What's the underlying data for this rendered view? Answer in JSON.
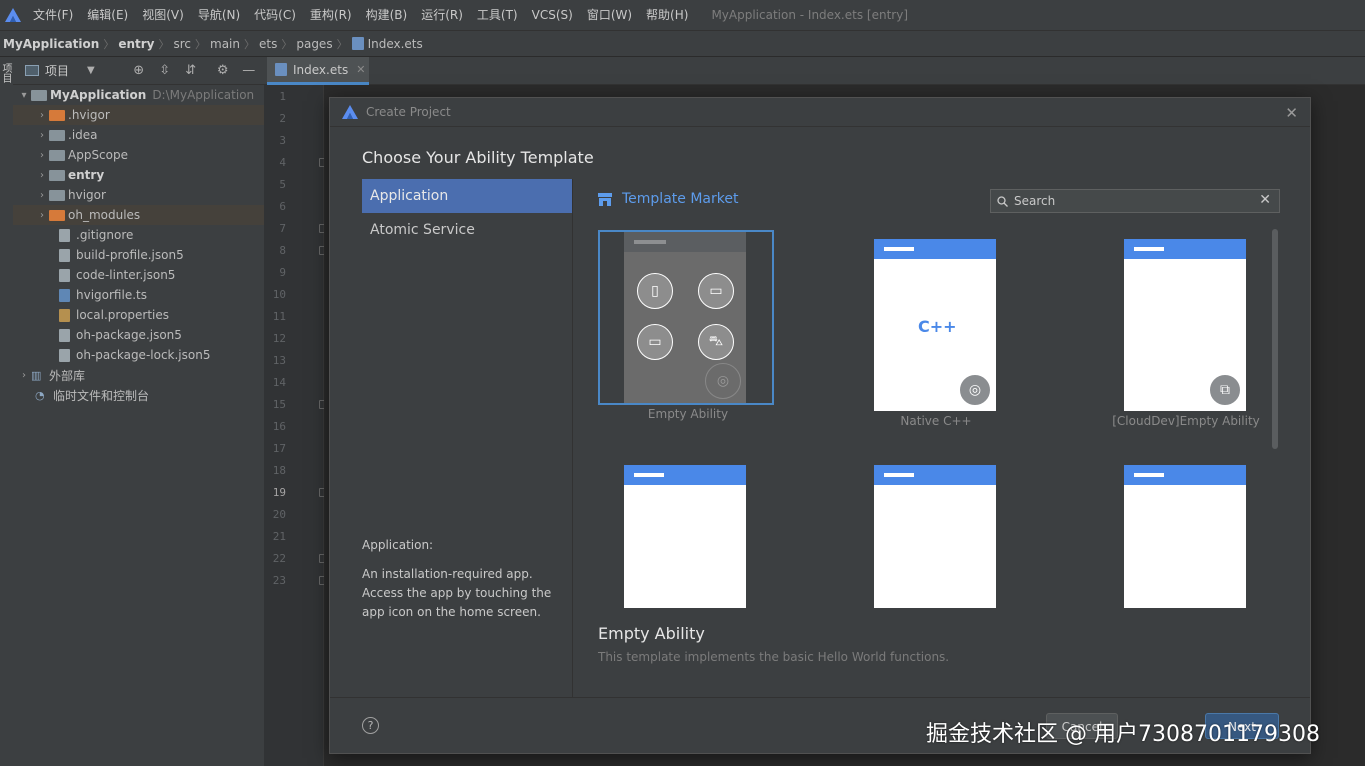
{
  "menu": {
    "items": [
      "文件(F)",
      "编辑(E)",
      "视图(V)",
      "导航(N)",
      "代码(C)",
      "重构(R)",
      "构建(B)",
      "运行(R)",
      "工具(T)",
      "VCS(S)",
      "窗口(W)",
      "帮助(H)"
    ],
    "window_title": "MyApplication - Index.ets [entry]"
  },
  "breadcrumb": [
    "MyApplication",
    "entry",
    "src",
    "main",
    "ets",
    "pages",
    "Index.ets"
  ],
  "left_stripe_label": "项目",
  "project_panel": {
    "title": "项目",
    "root": {
      "name": "MyApplication",
      "path": "D:\\MyApplication"
    },
    "items": [
      {
        "label": ".hvigor",
        "kind": "folder-orange"
      },
      {
        "label": ".idea",
        "kind": "folder"
      },
      {
        "label": "AppScope",
        "kind": "folder"
      },
      {
        "label": "entry",
        "kind": "folder-module"
      },
      {
        "label": "hvigor",
        "kind": "folder"
      },
      {
        "label": "oh_modules",
        "kind": "folder-orange"
      },
      {
        "label": ".gitignore",
        "kind": "file"
      },
      {
        "label": "build-profile.json5",
        "kind": "file"
      },
      {
        "label": "code-linter.json5",
        "kind": "file"
      },
      {
        "label": "hvigorfile.ts",
        "kind": "file"
      },
      {
        "label": "local.properties",
        "kind": "file"
      },
      {
        "label": "oh-package.json5",
        "kind": "file"
      },
      {
        "label": "oh-package-lock.json5",
        "kind": "file"
      }
    ],
    "external_libs": "外部库",
    "scratches": "临时文件和控制台"
  },
  "editor": {
    "tab_label": "Index.ets",
    "line_numbers": [
      "1",
      "2",
      "3",
      "4",
      "5",
      "6",
      "7",
      "8",
      "9",
      "10",
      "11",
      "12",
      "13",
      "14",
      "15",
      "16",
      "17",
      "18",
      "19",
      "20",
      "21",
      "22",
      "23"
    ],
    "current_line": "19"
  },
  "dialog": {
    "title": "Create Project",
    "heading": "Choose Your Ability Template",
    "nav": [
      {
        "label": "Application",
        "active": true
      },
      {
        "label": "Atomic Service",
        "active": false
      }
    ],
    "description_title": "Application:",
    "description_text": "An installation-required app. Access the app by touching the app icon on the home screen.",
    "template_market_label": "Template Market",
    "search_placeholder": "Search",
    "templates": [
      {
        "name": "Empty Ability",
        "selected": true
      },
      {
        "name": "Native C++",
        "selected": false
      },
      {
        "name": "[CloudDev]Empty Ability",
        "selected": false
      },
      {
        "name": "",
        "selected": false
      },
      {
        "name": "",
        "selected": false
      },
      {
        "name": "",
        "selected": false
      }
    ],
    "selected_template_title": "Empty Ability",
    "selected_template_desc": "This template implements the basic Hello World functions.",
    "cpp_label": "C++",
    "help_label": "?",
    "cancel_label": "Cancel",
    "next_label": "Next"
  },
  "watermark": "掘金技术社区 @ 用户7308701179308",
  "colors": {
    "accent": "#4b6eaf",
    "link": "#5d9cec",
    "template_bar": "#4a88e8"
  }
}
